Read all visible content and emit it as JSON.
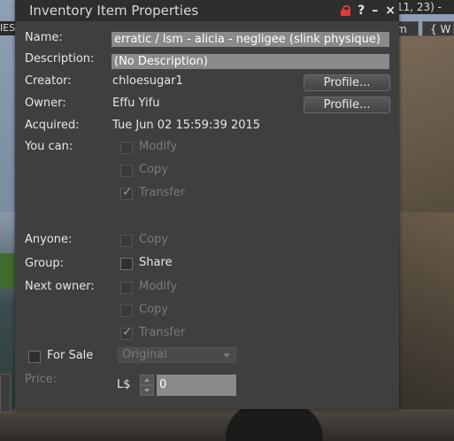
{
  "window": {
    "title": "Inventory Item Properties",
    "title_icons": [
      "lock-icon",
      "help-icon",
      "minimize-icon",
      "close-icon"
    ],
    "help_glyph": "?",
    "minimize_glyph": "–",
    "close_glyph": "×"
  },
  "background": {
    "coords_text": "11, 23) -",
    "left_tab_text": "IES",
    "button_m": "m",
    "button_w": "{ W"
  },
  "fields": {
    "name_label": "Name:",
    "name_value": "erratic / lsm - alicia - negligee (slink physique)",
    "description_label": "Description:",
    "description_value": "(No Description)",
    "creator_label": "Creator:",
    "creator_value": "chloesugar1",
    "owner_label": "Owner:",
    "owner_value": "Effu Yifu",
    "profile_button": "Profile...",
    "acquired_label": "Acquired:",
    "acquired_value": "Tue Jun 02 15:59:39 2015"
  },
  "permissions": {
    "you_can_label": "You can:",
    "you_can": [
      {
        "label": "Modify",
        "checked": false,
        "enabled": false
      },
      {
        "label": "Copy",
        "checked": false,
        "enabled": false
      },
      {
        "label": "Transfer",
        "checked": true,
        "enabled": false
      }
    ],
    "anyone_label": "Anyone:",
    "anyone": {
      "label": "Copy",
      "checked": false,
      "enabled": false
    },
    "group_label": "Group:",
    "group": {
      "label": "Share",
      "checked": false,
      "enabled": true
    },
    "next_owner_label": "Next owner:",
    "next_owner": [
      {
        "label": "Modify",
        "checked": false,
        "enabled": false
      },
      {
        "label": "Copy",
        "checked": false,
        "enabled": false
      },
      {
        "label": "Transfer",
        "checked": true,
        "enabled": false
      }
    ]
  },
  "sale": {
    "for_sale_label": "For Sale",
    "for_sale_checked": false,
    "sale_type": "Original",
    "price_label": "Price:",
    "currency": "L$",
    "price_value": "0"
  },
  "colors": {
    "panel_bg": "#3f3f3f",
    "titlebar_bg": "#2e2e2e",
    "lock_red": "#e23a3a",
    "field_bg": "#8a8a8a"
  }
}
